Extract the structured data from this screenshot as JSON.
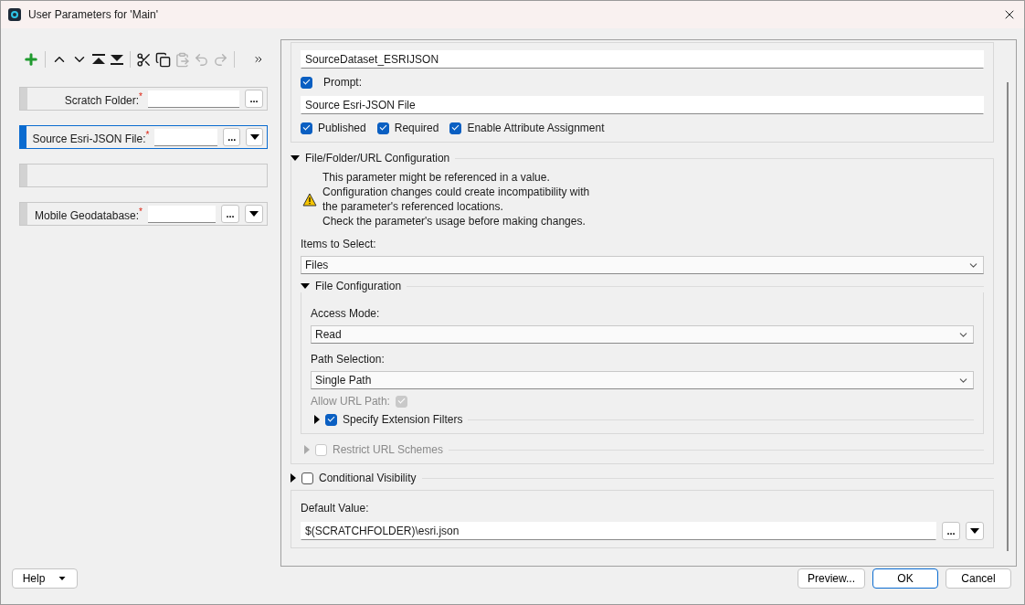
{
  "window": {
    "title": "User Parameters for 'Main'"
  },
  "toolbar": [
    {
      "kind": "add",
      "disabled": false
    },
    {
      "kind": "separator"
    },
    {
      "kind": "up",
      "disabled": false
    },
    {
      "kind": "down",
      "disabled": false
    },
    {
      "kind": "top",
      "disabled": false
    },
    {
      "kind": "bottom",
      "disabled": false
    },
    {
      "kind": "separator"
    },
    {
      "kind": "cut",
      "disabled": false
    },
    {
      "kind": "copy",
      "disabled": false
    },
    {
      "kind": "paste",
      "disabled": true
    },
    {
      "kind": "undo",
      "disabled": true
    },
    {
      "kind": "redo",
      "disabled": true
    },
    {
      "kind": "separator"
    },
    {
      "kind": "more",
      "disabled": false
    }
  ],
  "parameters": [
    {
      "kind": "field",
      "label": "Scratch Folder:",
      "marker": "*",
      "browse": "...",
      "dropdown": false,
      "selected": false
    },
    {
      "kind": "field",
      "label": "Source Esri-JSON File:",
      "marker": "*",
      "browse": "...",
      "dropdown": true,
      "selected": true
    },
    {
      "kind": "empty",
      "selected": false
    },
    {
      "kind": "field",
      "label": "Mobile Geodatabase:",
      "marker": "*",
      "browse": "...",
      "dropdown": true,
      "selected": false
    }
  ],
  "editor": {
    "name": "SourceDataset_ESRIJSON",
    "prompt": {
      "label": "Prompt:",
      "checked": true
    },
    "prompt_value": "Source Esri-JSON File",
    "flags": [
      {
        "label": "Published",
        "checked": true
      },
      {
        "label": "Required",
        "checked": true
      },
      {
        "label": "Enable Attribute Assignment",
        "checked": true
      }
    ],
    "config": {
      "title": "File/Folder/URL Configuration",
      "expanded": true,
      "warning": [
        "This parameter might be referenced in a value.",
        "Configuration changes could create incompatibility with",
        "the parameter's referenced locations.",
        "Check the parameter's usage before making changes."
      ],
      "items_label": "Items to Select:",
      "items_value": "Files",
      "file_config": {
        "title": "File Configuration",
        "expanded": true,
        "access_label": "Access Mode:",
        "access_value": "Read",
        "path_label": "Path Selection:",
        "path_value": "Single Path",
        "allow_url": {
          "label": "Allow URL Path:",
          "checked": true,
          "disabled": true
        },
        "ext_filters": {
          "label": "Specify Extension Filters",
          "checked": true,
          "expanded": false
        }
      },
      "restrict": {
        "label": "Restrict URL Schemes",
        "checked": false,
        "disabled": true,
        "expanded": false
      }
    },
    "visibility": {
      "label": "Conditional Visibility",
      "checked": false,
      "expanded": false
    },
    "default": {
      "label": "Default Value:",
      "value": "$(SCRATCHFOLDER)\\esri.json",
      "browse": "..."
    }
  },
  "footer": {
    "help": "Help",
    "buttons": [
      {
        "label": "Preview...",
        "default": false
      },
      {
        "label": "OK",
        "default": true
      },
      {
        "label": "Cancel",
        "default": false
      }
    ]
  }
}
